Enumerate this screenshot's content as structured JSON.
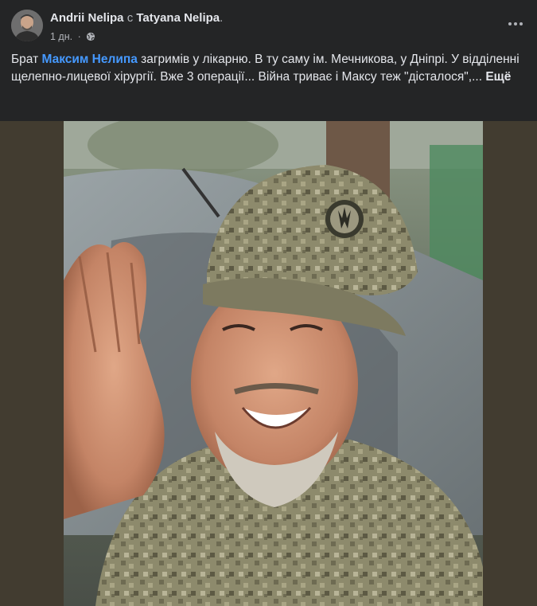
{
  "post": {
    "author": "Andrii Nelipa",
    "with_word": "с",
    "tagged": "Tatyana Nelipa",
    "period": ".",
    "time": "1 дн.",
    "sep": "·",
    "privacy_icon": "globe-icon",
    "more_icon": "more-options-icon",
    "text_before": "Брат ",
    "mention": "Максим Нелипа",
    "text_after": " загримів у лікарню. В ту саму ім. Мечникова, у Дніпрі. У відділенні щелепно-лицевої хірургії. Вже 3 операції... Війна триває і Максу теж \"дісталося\",... ",
    "see_more": "Ещё"
  },
  "colors": {
    "background": "#242526",
    "text": "#e4e6eb",
    "secondary": "#b0b3b8",
    "link": "#4599ff"
  }
}
